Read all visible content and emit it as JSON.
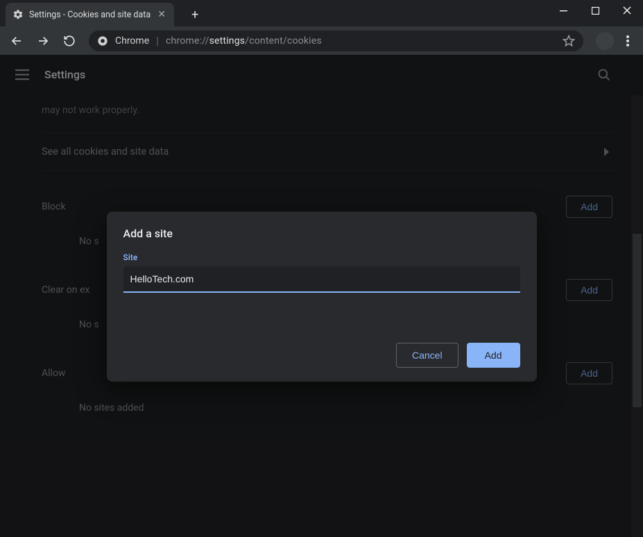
{
  "window": {
    "tab_title": "Settings - Cookies and site data"
  },
  "omnibox": {
    "brand": "Chrome",
    "url_prefix": "chrome://",
    "url_bold": "settings",
    "url_suffix": "/content/cookies"
  },
  "header": {
    "title": "Settings"
  },
  "page": {
    "truncated_hint": "may not work properly.",
    "see_all": "See all cookies and site data",
    "sections": {
      "block": {
        "label": "Block",
        "add": "Add",
        "empty_prefix": "No s"
      },
      "clear": {
        "label": "Clear on ex",
        "add": "Add",
        "empty_prefix": "No s"
      },
      "allow": {
        "label": "Allow",
        "add": "Add",
        "empty": "No sites added"
      }
    }
  },
  "dialog": {
    "title": "Add a site",
    "field_label": "Site",
    "input_value": "HelloTech.com",
    "cancel": "Cancel",
    "confirm": "Add"
  }
}
